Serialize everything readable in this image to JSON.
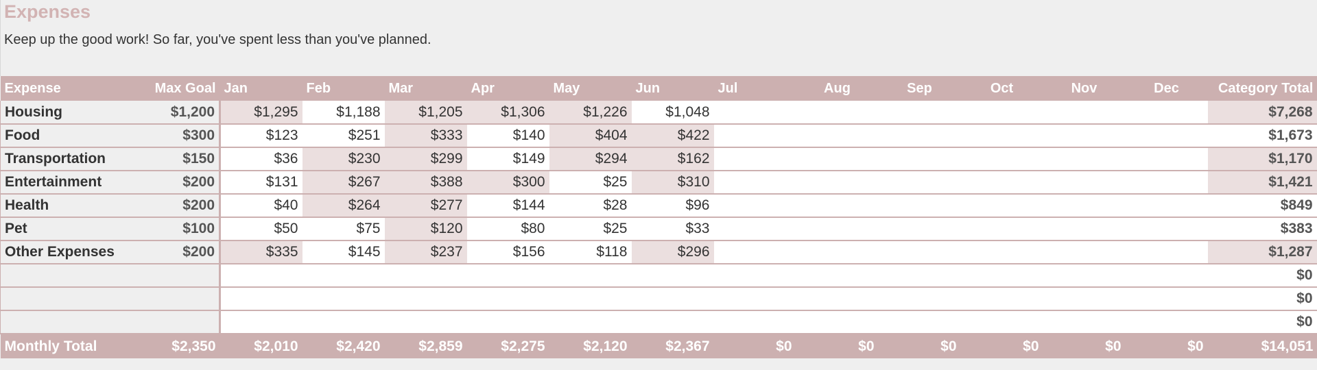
{
  "page": {
    "title": "Expenses",
    "subtitle": "Keep up the good work! So far, you've spent less than you've planned."
  },
  "colors": {
    "accent": "#ccb0b0",
    "title": "#d2b3b3",
    "over_goal_highlight": "#ebdfdf",
    "background": "#efefef"
  },
  "table": {
    "headers": {
      "expense": "Expense",
      "max_goal": "Max Goal",
      "months": [
        "Jan",
        "Feb",
        "Mar",
        "Apr",
        "May",
        "Jun",
        "Jul",
        "Aug",
        "Sep",
        "Oct",
        "Nov",
        "Dec"
      ],
      "category_total": "Category Total"
    },
    "rows": [
      {
        "label": "Housing",
        "goal": "$1,200",
        "months": [
          "$1,295",
          "$1,188",
          "$1,205",
          "$1,306",
          "$1,226",
          "$1,048",
          "",
          "",
          "",
          "",
          "",
          ""
        ],
        "over": [
          true,
          false,
          true,
          true,
          true,
          false,
          false,
          false,
          false,
          false,
          false,
          false
        ],
        "total": "$7,268",
        "total_over": true
      },
      {
        "label": "Food",
        "goal": "$300",
        "months": [
          "$123",
          "$251",
          "$333",
          "$140",
          "$404",
          "$422",
          "",
          "",
          "",
          "",
          "",
          ""
        ],
        "over": [
          false,
          false,
          true,
          false,
          true,
          true,
          false,
          false,
          false,
          false,
          false,
          false
        ],
        "total": "$1,673",
        "total_over": false
      },
      {
        "label": "Transportation",
        "goal": "$150",
        "months": [
          "$36",
          "$230",
          "$299",
          "$149",
          "$294",
          "$162",
          "",
          "",
          "",
          "",
          "",
          ""
        ],
        "over": [
          false,
          true,
          true,
          false,
          true,
          true,
          false,
          false,
          false,
          false,
          false,
          false
        ],
        "total": "$1,170",
        "total_over": true
      },
      {
        "label": "Entertainment",
        "goal": "$200",
        "months": [
          "$131",
          "$267",
          "$388",
          "$300",
          "$25",
          "$310",
          "",
          "",
          "",
          "",
          "",
          ""
        ],
        "over": [
          false,
          true,
          true,
          true,
          false,
          true,
          false,
          false,
          false,
          false,
          false,
          false
        ],
        "total": "$1,421",
        "total_over": true
      },
      {
        "label": "Health",
        "goal": "$200",
        "months": [
          "$40",
          "$264",
          "$277",
          "$144",
          "$28",
          "$96",
          "",
          "",
          "",
          "",
          "",
          ""
        ],
        "over": [
          false,
          true,
          true,
          false,
          false,
          false,
          false,
          false,
          false,
          false,
          false,
          false
        ],
        "total": "$849",
        "total_over": false
      },
      {
        "label": "Pet",
        "goal": "$100",
        "months": [
          "$50",
          "$75",
          "$120",
          "$80",
          "$25",
          "$33",
          "",
          "",
          "",
          "",
          "",
          ""
        ],
        "over": [
          false,
          false,
          true,
          false,
          false,
          false,
          false,
          false,
          false,
          false,
          false,
          false
        ],
        "total": "$383",
        "total_over": false
      },
      {
        "label": "Other Expenses",
        "goal": "$200",
        "months": [
          "$335",
          "$145",
          "$237",
          "$156",
          "$118",
          "$296",
          "",
          "",
          "",
          "",
          "",
          ""
        ],
        "over": [
          true,
          false,
          true,
          false,
          false,
          true,
          false,
          false,
          false,
          false,
          false,
          false
        ],
        "total": "$1,287",
        "total_over": true
      },
      {
        "label": "",
        "goal": "",
        "months": [
          "",
          "",
          "",
          "",
          "",
          "",
          "",
          "",
          "",
          "",
          "",
          ""
        ],
        "over": [
          false,
          false,
          false,
          false,
          false,
          false,
          false,
          false,
          false,
          false,
          false,
          false
        ],
        "total": "$0",
        "total_over": false
      },
      {
        "label": "",
        "goal": "",
        "months": [
          "",
          "",
          "",
          "",
          "",
          "",
          "",
          "",
          "",
          "",
          "",
          ""
        ],
        "over": [
          false,
          false,
          false,
          false,
          false,
          false,
          false,
          false,
          false,
          false,
          false,
          false
        ],
        "total": "$0",
        "total_over": false
      },
      {
        "label": "",
        "goal": "",
        "months": [
          "",
          "",
          "",
          "",
          "",
          "",
          "",
          "",
          "",
          "",
          "",
          ""
        ],
        "over": [
          false,
          false,
          false,
          false,
          false,
          false,
          false,
          false,
          false,
          false,
          false,
          false
        ],
        "total": "$0",
        "total_over": false
      }
    ],
    "footer": {
      "label": "Monthly Total",
      "goal": "$2,350",
      "months": [
        "$2,010",
        "$2,420",
        "$2,859",
        "$2,275",
        "$2,120",
        "$2,367",
        "$0",
        "$0",
        "$0",
        "$0",
        "$0",
        "$0"
      ],
      "total": "$14,051"
    }
  }
}
